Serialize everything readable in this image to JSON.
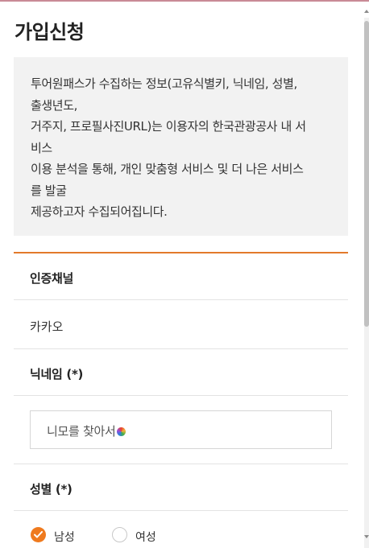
{
  "header": {
    "title": "가입신청"
  },
  "notice": {
    "lines": [
      "투어원패스가 수집하는 정보(고유식별키, 닉네임, 성별,",
      "출생년도,",
      "거주지, 프로필사진URL)는 이용자의 한국관광공사 내 서",
      "비스",
      "이용 분석을 통해, 개인 맞춤형 서비스 및 더 나은 서비스",
      "를 발굴",
      "제공하고자 수집되어집니다."
    ]
  },
  "form": {
    "auth_channel": {
      "label": "인증채널",
      "value": "카카오"
    },
    "nickname": {
      "label": "닉네임 (*)",
      "value": "니모를 찾아서"
    },
    "gender": {
      "label": "성별 (*)",
      "options": [
        {
          "label": "남성",
          "checked": true
        },
        {
          "label": "여성",
          "checked": false
        }
      ]
    }
  },
  "colors": {
    "accent": "#ef7a1e",
    "rule": "#e27a2b",
    "notice_bg": "#f2f2f2"
  }
}
